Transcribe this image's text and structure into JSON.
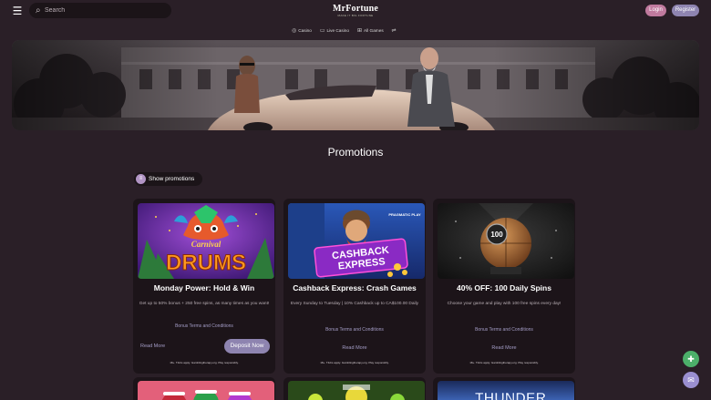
{
  "topbar": {
    "search_placeholder": "Search",
    "logo_name": "MrFortune",
    "logo_tagline": "MAKE IT BIG FORTUNE",
    "login_label": "Login",
    "register_label": "Register"
  },
  "categories": [
    {
      "label": "Casino",
      "icon": "roulette-icon"
    },
    {
      "label": "Live Casino",
      "icon": "tv-icon"
    },
    {
      "label": "All Games",
      "icon": "grid-icon"
    }
  ],
  "page": {
    "title": "Promotions",
    "show_promotions_label": "Show promotions"
  },
  "promotions": [
    {
      "title": "Monday Power: Hold & Win",
      "description": "Get up to 50% bonus + 250 free spins, as many times as you want!",
      "terms_label": "Bonus Terms and Conditions",
      "read_more_label": "Read More",
      "deposit_label": "Deposit Now",
      "disclaimer": "18+. T&Cs apply. Gamblingtherapy.org. Play responsibly.",
      "image_text": "CARNIVAL DRUMS"
    },
    {
      "title": "Cashback Express: Crash Games",
      "description": "Every Sunday to Tuesday | 10% Cashback up to CA$100.00 Daily",
      "terms_label": "Bonus Terms and Conditions",
      "read_more_label": "Read More",
      "disclaimer": "18+. T&Cs apply. Gamblingtherapy.org. Play responsibly.",
      "image_text": "CASHBACK EXPRESS",
      "image_brand": "PRAGMATIC PLAY"
    },
    {
      "title": "40% OFF: 100 Daily Spins",
      "description": "Choose your game and play with 100 free spins every day!",
      "terms_label": "Bonus Terms and Conditions",
      "read_more_label": "Read More",
      "disclaimer": "18+. T&Cs apply. Gamblingtherapy.org. Play responsibly.",
      "image_text": "100"
    }
  ],
  "next_row_image_text": "THUNDER",
  "colors": {
    "background": "#2a1f27",
    "card": "#1c1419",
    "accent_purple": "#8e84b0",
    "accent_pink": "#c07a9e",
    "link": "#a59ec8",
    "fab_green": "#4caf6a",
    "fab_purple": "#9a8fd0"
  }
}
